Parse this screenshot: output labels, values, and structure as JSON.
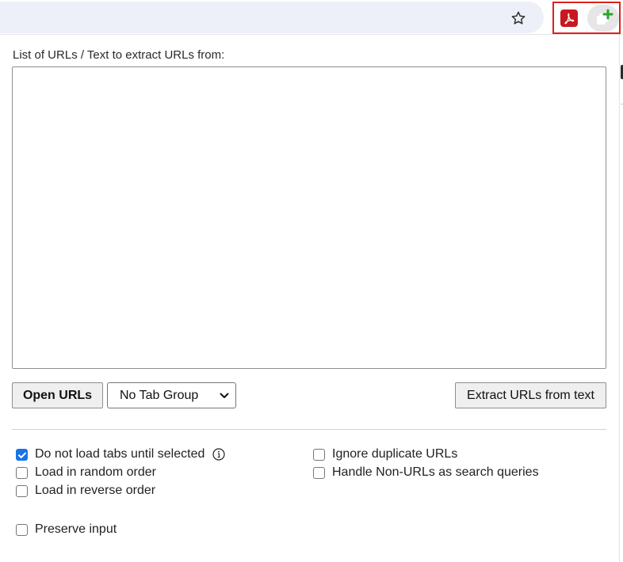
{
  "toolbar": {
    "bookmark_icon": "star-outline-icon",
    "extensions": [
      {
        "name": "Adobe Acrobat",
        "icon": "acrobat-pdf-icon",
        "color": "#c8191f"
      },
      {
        "name": "Open Multiple URLs",
        "icon": "tab-plus-icon",
        "color": "#2aa52a"
      }
    ],
    "highlight_color": "#e0201b"
  },
  "popup": {
    "textarea_label": "List of URLs / Text to extract URLs from:",
    "textarea_value": "",
    "open_button_label": "Open URLs",
    "tab_group_select": {
      "selected": "No Tab Group",
      "options": [
        "No Tab Group"
      ]
    },
    "extract_button_label": "Extract URLs from text",
    "options": {
      "lazy_load": {
        "label": "Do not load tabs until selected",
        "checked": true,
        "info_icon": "info-circle-icon"
      },
      "random_order": {
        "label": "Load in random order",
        "checked": false
      },
      "reverse_order": {
        "label": "Load in reverse order",
        "checked": false
      },
      "ignore_duplicates": {
        "label": "Ignore duplicate URLs",
        "checked": false
      },
      "non_urls_search": {
        "label": "Handle Non-URLs as search queries",
        "checked": false
      },
      "preserve_input": {
        "label": "Preserve input",
        "checked": false
      }
    },
    "accent_color": "#1a73e8"
  }
}
